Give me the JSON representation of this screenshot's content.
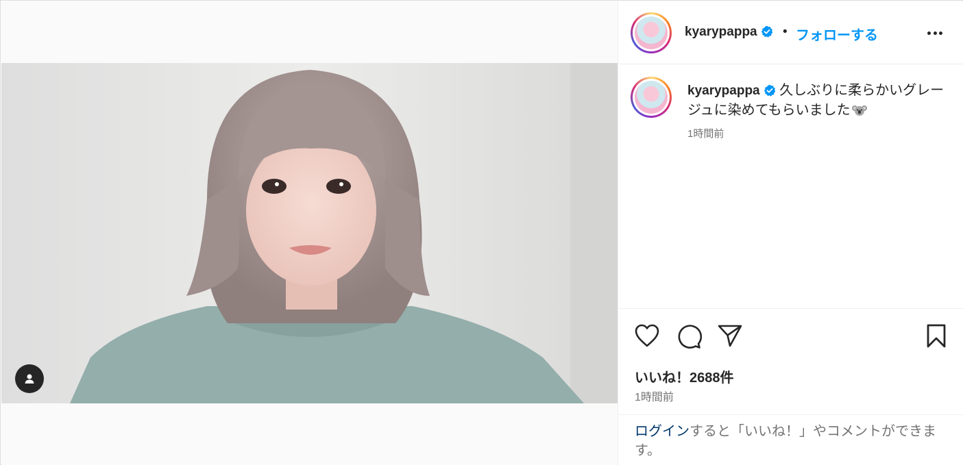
{
  "author": {
    "username": "kyarypappa",
    "verified": true
  },
  "header": {
    "separator": "•",
    "follow_label": "フォローする"
  },
  "caption": {
    "text": "久しぶりに柔らかいグレージュに染めてもらいました",
    "emoji": "koala-icon",
    "time": "1時間前"
  },
  "stats": {
    "likes_label": "いいね！2688件",
    "time": "1時間前"
  },
  "login_prompt": {
    "link": "ログイン",
    "rest": "すると「いいね！」やコメントができます。"
  },
  "colors": {
    "link_blue": "#0095f6",
    "login_link": "#00376b",
    "muted": "#737373",
    "text": "#262626"
  }
}
